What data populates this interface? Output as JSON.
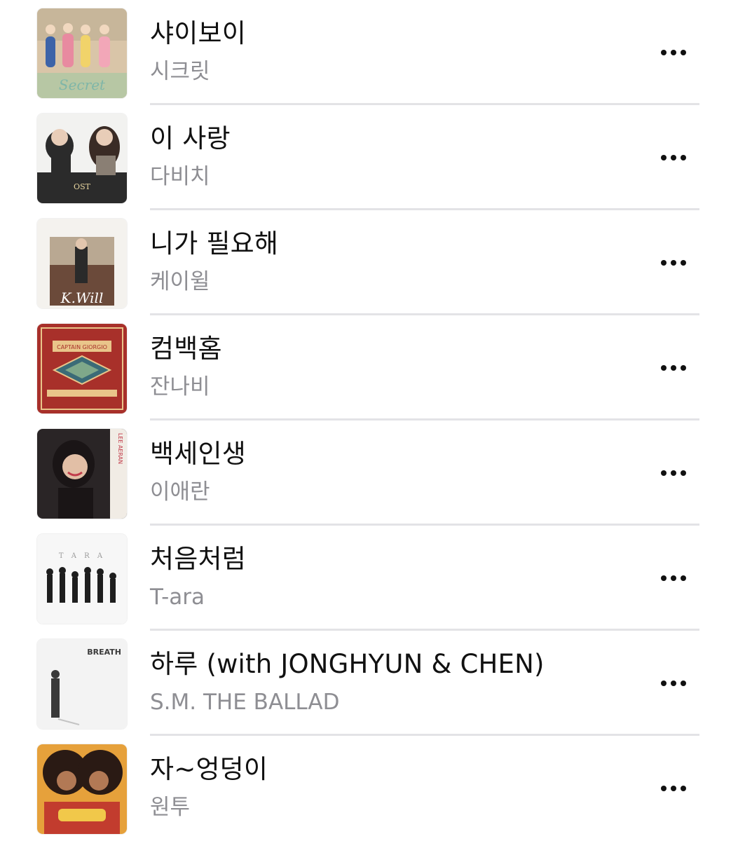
{
  "songs": [
    {
      "title": "샤이보이",
      "artist": "시크릿",
      "artwork_icon": "album-artwork-shy-boy",
      "artwork_text": "Secret",
      "colors": [
        "#d9c5a8",
        "#7fb6a8",
        "#e88aa0"
      ]
    },
    {
      "title": "이 사랑",
      "artist": "다비치",
      "artwork_icon": "album-artwork-this-love",
      "artwork_text": "",
      "colors": [
        "#f2f2f0",
        "#2b2b2b",
        "#8a7f74"
      ]
    },
    {
      "title": "니가 필요해",
      "artist": "케이윌",
      "artwork_icon": "album-artwork-i-need-you",
      "artwork_text": "K.Will",
      "colors": [
        "#f4f2ee",
        "#6b4a3a",
        "#b9a892"
      ]
    },
    {
      "title": "컴백홈",
      "artist": "잔나비",
      "artwork_icon": "album-artwork-captain-giorgio",
      "artwork_text": "CAPTAIN GIORGIO",
      "colors": [
        "#a8302a",
        "#3b6b77",
        "#e9c58a"
      ]
    },
    {
      "title": "백세인생",
      "artist": "이애란",
      "artwork_icon": "album-artwork-lee-aeran",
      "artwork_text": "LEE AERAN",
      "colors": [
        "#2a2526",
        "#f1ece5",
        "#c13b4a"
      ]
    },
    {
      "title": "처음처럼",
      "artist": "T-ara",
      "artwork_icon": "album-artwork-tara",
      "artwork_text": "T A R A",
      "colors": [
        "#f7f7f7",
        "#1e1e1e",
        "#9a9a9a"
      ]
    },
    {
      "title": "하루 (with JONGHYUN & CHEN)",
      "artist": "S.M. THE BALLAD",
      "artwork_icon": "album-artwork-breath",
      "artwork_text": "BREATH",
      "colors": [
        "#f3f3f3",
        "#3a3a3a",
        "#c4c4c4"
      ]
    },
    {
      "title": "자~엉덩이",
      "artist": "원투",
      "artwork_icon": "album-artwork-one-two",
      "artwork_text": "",
      "colors": [
        "#e6a13b",
        "#2a1a14",
        "#c23c2e"
      ]
    }
  ],
  "more_icon": "more-horizontal-icon"
}
